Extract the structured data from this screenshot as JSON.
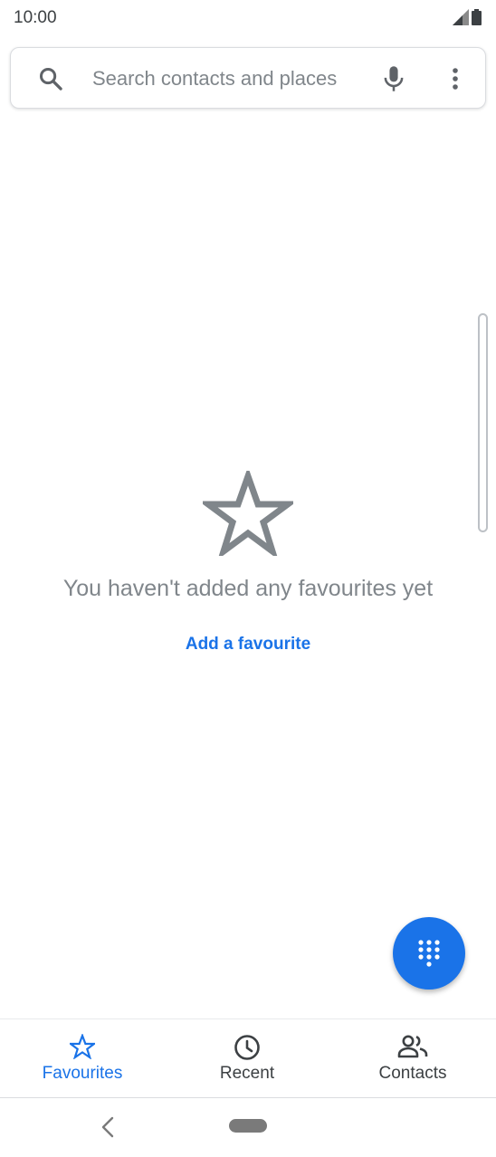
{
  "status_bar": {
    "time": "10:00",
    "icons": [
      "signal-icon",
      "battery-icon"
    ]
  },
  "search": {
    "placeholder": "Search contacts and places",
    "value": "",
    "icons": [
      "search-icon",
      "mic-icon",
      "more-vert-icon"
    ]
  },
  "empty_state": {
    "icon": "star-outline-icon",
    "message": "You haven't added any favourites yet",
    "action_label": "Add a favourite"
  },
  "fab": {
    "icon": "dialpad-icon"
  },
  "bottom_nav": {
    "items": [
      {
        "label": "Favourites",
        "icon": "star-icon",
        "active": true
      },
      {
        "label": "Recent",
        "icon": "clock-icon",
        "active": false
      },
      {
        "label": "Contacts",
        "icon": "people-icon",
        "active": false
      }
    ]
  },
  "system_nav": {
    "icons": [
      "back-icon",
      "home-pill"
    ]
  },
  "colors": {
    "accent": "#1a73e8",
    "icon_gray": "#5f6368",
    "secondary_text": "#80868b",
    "star_outline": "#80868b"
  }
}
